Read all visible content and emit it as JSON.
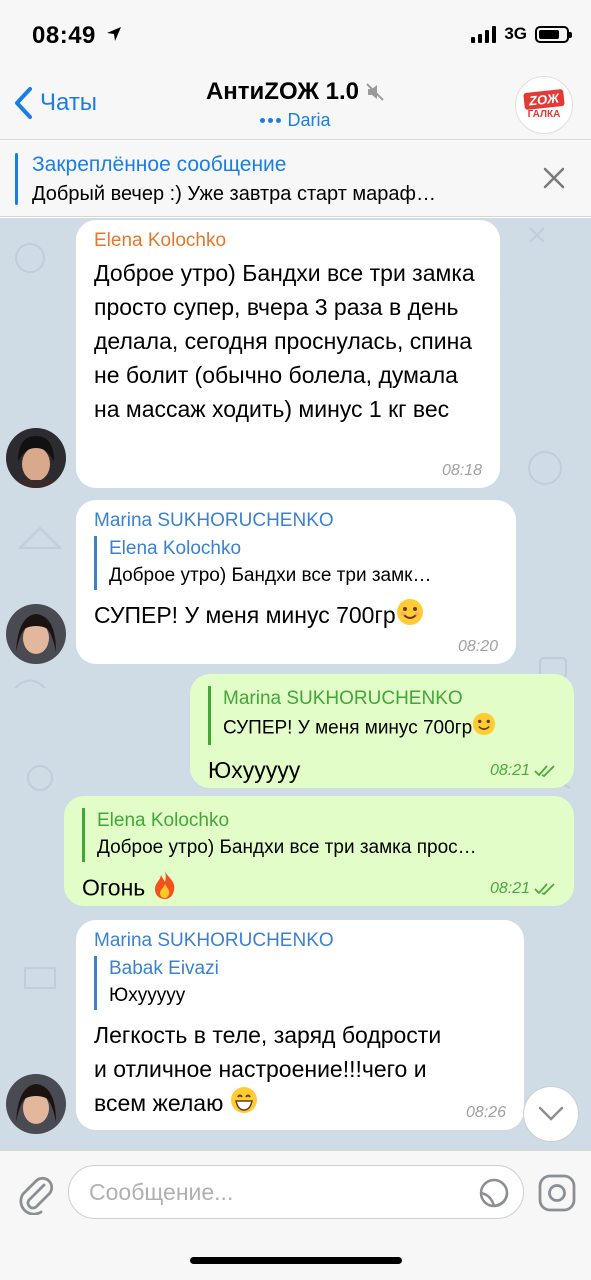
{
  "status": {
    "time": "08:49",
    "network": "3G"
  },
  "header": {
    "back_label": "Чаты",
    "title": "АнтиZОЖ 1.0",
    "subtitle": "Daria",
    "avatar_top": "ZOЖ",
    "avatar_bottom": "ГАЛКА"
  },
  "pinned": {
    "title": "Закреплённое сообщение",
    "text": "Добрый вечер :)    Уже завтра старт мараф…"
  },
  "messages": [
    {
      "sender": "Elena Kolochko",
      "text": "Доброе утро) Бандхи все три замка просто супер, вчера 3 раза в день делала, сегодня проснулась, спина не болит (обычно болела, думала на массаж ходить) минус 1 кг вес",
      "time": "08:18"
    },
    {
      "sender": "Marina SUKHORUCHENKO",
      "reply_name": "Elena Kolochko",
      "reply_text": "Доброе утро) Бандхи все три замк…",
      "text": "СУПЕР! У меня минус 700гр",
      "time": "08:20"
    },
    {
      "sender": "Marina SUKHORUCHENKO",
      "reply_text": "СУПЕР! У меня минус 700гр",
      "text": "Юхууууу",
      "time": "08:21"
    },
    {
      "reply_name": "Elena Kolochko",
      "reply_text": "Доброе утро) Бандхи все три замка прос…",
      "text": "Огонь",
      "time": "08:21"
    },
    {
      "sender": "Marina SUKHORUCHENKO",
      "reply_name": "Babak Eivazi",
      "reply_text": "Юхууууу",
      "text": "Легкость в теле, заряд бодрости и отличное настроение!!!чего и всем желаю",
      "time": "08:26"
    }
  ],
  "input": {
    "placeholder": "Сообщение..."
  },
  "colors": {
    "accent": "#1a7ee6",
    "incoming_bubble": "#ffffff",
    "outgoing_bubble": "#e2fdc8",
    "chat_background": "#cfdce6"
  },
  "icons": {
    "back": "chevron-left-icon",
    "mute": "muted-speaker-icon",
    "close": "close-icon",
    "attach": "paperclip-icon",
    "sticker": "sticker-icon",
    "camera": "camera-icon",
    "scroll": "chevron-down-icon",
    "read": "double-check-icon"
  }
}
